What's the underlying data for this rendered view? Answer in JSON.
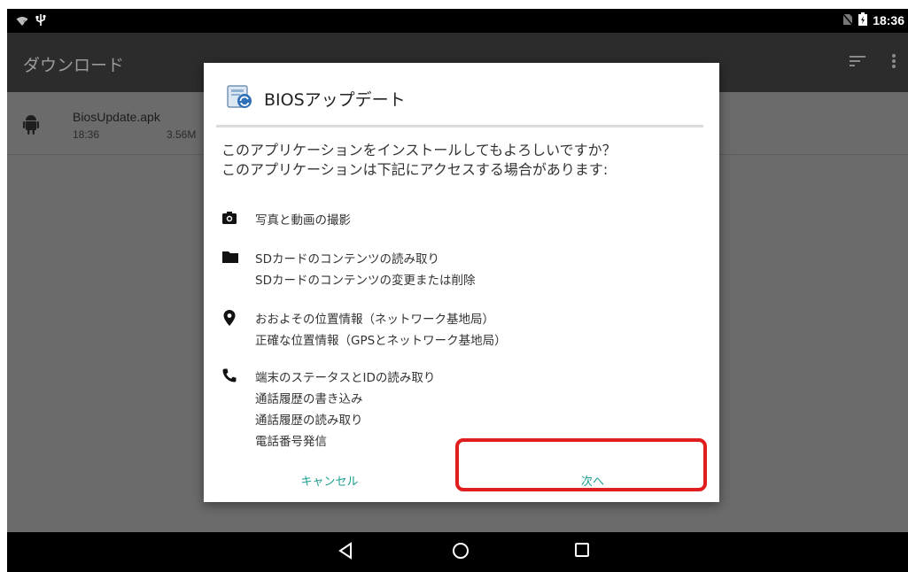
{
  "status_bar": {
    "time": "18:36",
    "icons": [
      "wifi-icon",
      "usb-icon",
      "no-sim-icon",
      "battery-icon"
    ]
  },
  "app_bar": {
    "title": "ダウンロード",
    "actions": [
      "sort-icon",
      "overflow-menu-icon"
    ]
  },
  "downloads": [
    {
      "name": "BiosUpdate.apk",
      "time": "18:36",
      "size": "3.56M"
    }
  ],
  "dialog": {
    "app_icon": "bios-update-app-icon",
    "title": "BIOSアップデート",
    "question_lines": [
      "このアプリケーションをインストールしてもよろしいですか？",
      "このアプリケーションは下記にアクセスする場合があります:"
    ],
    "permissions": [
      {
        "icon": "camera-icon",
        "lines": [
          "写真と動画の撮影"
        ]
      },
      {
        "icon": "folder-icon",
        "lines": [
          "SDカードのコンテンツの読み取り",
          "SDカードのコンテンツの変更または削除"
        ]
      },
      {
        "icon": "location-pin-icon",
        "lines": [
          "おおよその位置情報（ネットワーク基地局）",
          "正確な位置情報（GPSとネットワーク基地局）"
        ]
      },
      {
        "icon": "phone-icon",
        "lines": [
          "端末のステータスとIDの読み取り",
          "通話履歴の書き込み",
          "通話履歴の読み取り",
          "電話番号発信"
        ]
      }
    ],
    "cancel_label": "キャンセル",
    "next_label": "次へ"
  },
  "nav_bar": [
    "back-icon",
    "home-icon",
    "recents-icon"
  ],
  "colors": {
    "accent": "#1a9e8f",
    "highlight": "#e11e1e",
    "app_bar": "#2c2c2c",
    "scrim": "#6b6b6b"
  }
}
